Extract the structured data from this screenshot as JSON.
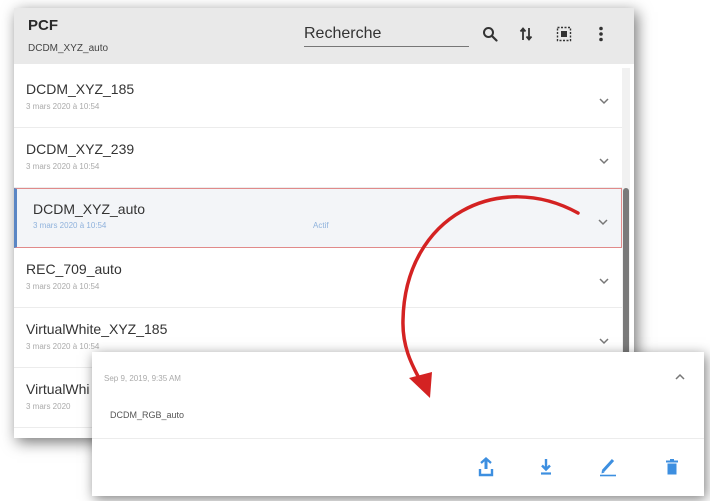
{
  "header": {
    "title": "PCF",
    "subtitle": "DCDM_XYZ_auto",
    "search_placeholder": "Recherche",
    "icons": [
      "search-icon",
      "sort-icon",
      "select-all-icon",
      "more-vert-icon"
    ]
  },
  "list": {
    "items": [
      {
        "name": "DCDM_XYZ_185",
        "date": "3 mars 2020 à 10:54",
        "status": ""
      },
      {
        "name": "DCDM_XYZ_239",
        "date": "3 mars 2020 à 10:54",
        "status": ""
      },
      {
        "name": "DCDM_XYZ_auto",
        "date": "3 mars 2020 à 10:54",
        "status": "Actif"
      },
      {
        "name": "REC_709_auto",
        "date": "3 mars 2020 à 10:54",
        "status": ""
      },
      {
        "name": "VirtualWhite_XYZ_185",
        "date": "3 mars 2020 à 10:54",
        "status": ""
      },
      {
        "name": "VirtualWhi",
        "date": "3 mars 2020",
        "status": ""
      }
    ]
  },
  "detail": {
    "date": "Sep 9, 2019, 9:35 AM",
    "name": "DCDM_RGB_auto",
    "actions": [
      "upload-icon",
      "download-icon",
      "edit-icon",
      "delete-icon"
    ]
  },
  "colors": {
    "accent": "#3d8fe0",
    "active_border": "#e18a8a",
    "active_bar": "#5a86c4",
    "arrow": "#d42222",
    "header_bg": "#e9e9e9"
  }
}
